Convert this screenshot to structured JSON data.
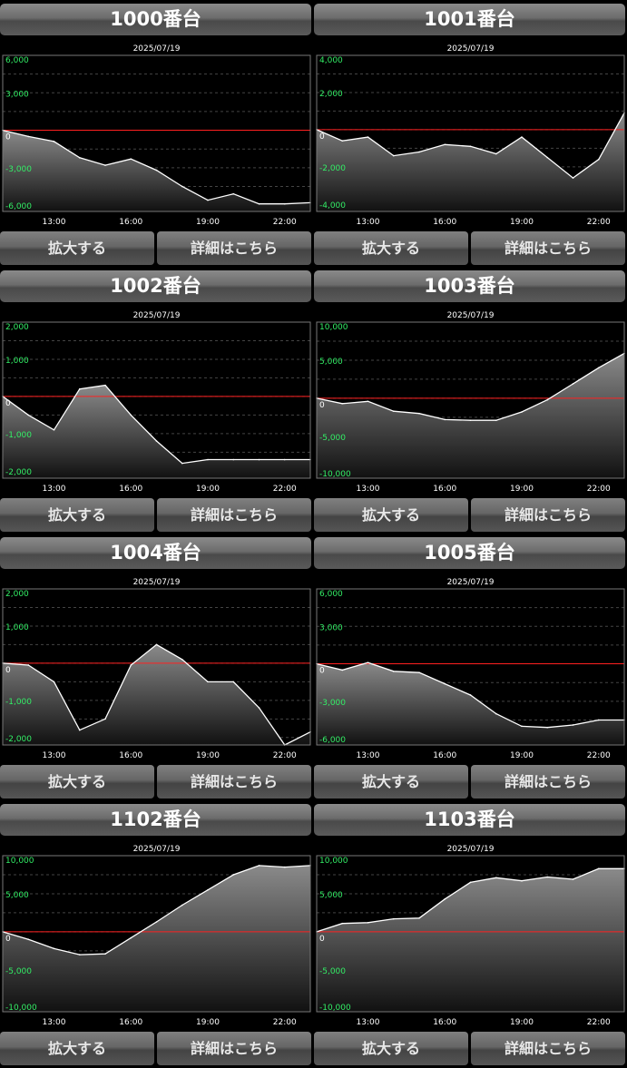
{
  "buttons": {
    "zoom_label": "拡大する",
    "detail_label": "詳細はこちら"
  },
  "colors": {
    "axis_label": "#33ee66",
    "zero_line": "#ff2020",
    "line": "#ffffff",
    "frame": "#777777",
    "grid": "#444444"
  },
  "chart_data": [
    {
      "type": "area",
      "title": "1000番台",
      "date": "2025/07/19",
      "x": [
        "11:00",
        "12:00",
        "13:00",
        "14:00",
        "15:00",
        "16:00",
        "17:00",
        "18:00",
        "19:00",
        "20:00",
        "21:00",
        "22:00",
        "23:00"
      ],
      "xticks": [
        "13:00",
        "16:00",
        "19:00",
        "22:00"
      ],
      "yticks": [
        6000,
        3000,
        0,
        -3000,
        -6000
      ],
      "ytick_labels": [
        "6,000",
        "3,000",
        "0",
        "-3,000",
        "-6,000"
      ],
      "ylim": [
        -6500,
        6000
      ],
      "values": [
        0,
        -500,
        -900,
        -2200,
        -2800,
        -2300,
        -3200,
        -4500,
        -5600,
        -5100,
        -5900,
        -5900,
        -5800
      ]
    },
    {
      "type": "area",
      "title": "1001番台",
      "date": "2025/07/19",
      "x": [
        "11:00",
        "12:00",
        "13:00",
        "14:00",
        "15:00",
        "16:00",
        "17:00",
        "18:00",
        "19:00",
        "20:00",
        "21:00",
        "22:00",
        "23:00"
      ],
      "xticks": [
        "13:00",
        "16:00",
        "19:00",
        "22:00"
      ],
      "yticks": [
        4000,
        2000,
        0,
        -2000,
        -4000
      ],
      "ytick_labels": [
        "4,000",
        "2,000",
        "0",
        "-2,000",
        "-4,000"
      ],
      "ylim": [
        -4400,
        4000
      ],
      "values": [
        0,
        -600,
        -400,
        -1400,
        -1200,
        -800,
        -900,
        -1300,
        -400,
        -1500,
        -2600,
        -1600,
        900
      ]
    },
    {
      "type": "area",
      "title": "1002番台",
      "date": "2025/07/19",
      "x": [
        "11:00",
        "12:00",
        "13:00",
        "14:00",
        "15:00",
        "16:00",
        "17:00",
        "18:00",
        "19:00",
        "20:00",
        "21:00",
        "22:00",
        "23:00"
      ],
      "xticks": [
        "13:00",
        "16:00",
        "19:00",
        "22:00"
      ],
      "yticks": [
        2000,
        1000,
        0,
        -1000,
        -2000
      ],
      "ytick_labels": [
        "2,000",
        "1,000",
        "0",
        "-1,000",
        "-2,000"
      ],
      "ylim": [
        -2200,
        2000
      ],
      "values": [
        0,
        -500,
        -900,
        200,
        300,
        -500,
        -1200,
        -1800,
        -1700,
        -1700,
        -1700,
        -1700,
        -1700
      ]
    },
    {
      "type": "area",
      "title": "1003番台",
      "date": "2025/07/19",
      "x": [
        "11:00",
        "12:00",
        "13:00",
        "14:00",
        "15:00",
        "16:00",
        "17:00",
        "18:00",
        "19:00",
        "20:00",
        "21:00",
        "22:00",
        "23:00"
      ],
      "xticks": [
        "13:00",
        "16:00",
        "19:00",
        "22:00"
      ],
      "yticks": [
        10000,
        5000,
        0,
        -5000,
        -10000
      ],
      "ytick_labels": [
        "10,000",
        "5,000",
        "0",
        "-5,000",
        "-10,000"
      ],
      "ylim": [
        -10500,
        10000
      ],
      "values": [
        0,
        -700,
        -400,
        -1700,
        -2000,
        -2800,
        -2900,
        -2900,
        -1800,
        -200,
        1900,
        4000,
        5900
      ]
    },
    {
      "type": "area",
      "title": "1004番台",
      "date": "2025/07/19",
      "x": [
        "11:00",
        "12:00",
        "13:00",
        "14:00",
        "15:00",
        "16:00",
        "17:00",
        "18:00",
        "19:00",
        "20:00",
        "21:00",
        "22:00",
        "23:00"
      ],
      "xticks": [
        "13:00",
        "16:00",
        "19:00",
        "22:00"
      ],
      "yticks": [
        2000,
        1000,
        0,
        -1000,
        -2000
      ],
      "ytick_labels": [
        "2,000",
        "1,000",
        "0",
        "-1,000",
        "-2,000"
      ],
      "ylim": [
        -2200,
        2000
      ],
      "values": [
        0,
        -50,
        -500,
        -1800,
        -1500,
        -50,
        500,
        100,
        -500,
        -500,
        -1200,
        -2200,
        -1850
      ]
    },
    {
      "type": "area",
      "title": "1005番台",
      "date": "2025/07/19",
      "x": [
        "11:00",
        "12:00",
        "13:00",
        "14:00",
        "15:00",
        "16:00",
        "17:00",
        "18:00",
        "19:00",
        "20:00",
        "21:00",
        "22:00",
        "23:00"
      ],
      "xticks": [
        "13:00",
        "16:00",
        "19:00",
        "22:00"
      ],
      "yticks": [
        6000,
        3000,
        0,
        -3000,
        -6000
      ],
      "ytick_labels": [
        "6,000",
        "3,000",
        "0",
        "-3,000",
        "-6,000"
      ],
      "ylim": [
        -6500,
        6000
      ],
      "values": [
        0,
        -500,
        100,
        -600,
        -700,
        -1600,
        -2500,
        -4000,
        -5000,
        -5100,
        -4900,
        -4500,
        -4500
      ]
    },
    {
      "type": "area",
      "title": "1102番台",
      "date": "2025/07/19",
      "x": [
        "11:00",
        "12:00",
        "13:00",
        "14:00",
        "15:00",
        "16:00",
        "17:00",
        "18:00",
        "19:00",
        "20:00",
        "21:00",
        "22:00",
        "23:00"
      ],
      "xticks": [
        "13:00",
        "16:00",
        "19:00",
        "22:00"
      ],
      "yticks": [
        10000,
        5000,
        0,
        -5000,
        -10000
      ],
      "ytick_labels": [
        "10,000",
        "5,000",
        "0",
        "-5,000",
        "-10,000"
      ],
      "ylim": [
        -10500,
        10000
      ],
      "values": [
        0,
        -1000,
        -2200,
        -3000,
        -2900,
        -800,
        1300,
        3500,
        5500,
        7500,
        8700,
        8500,
        8700
      ]
    },
    {
      "type": "area",
      "title": "1103番台",
      "date": "2025/07/19",
      "x": [
        "11:00",
        "12:00",
        "13:00",
        "14:00",
        "15:00",
        "16:00",
        "17:00",
        "18:00",
        "19:00",
        "20:00",
        "21:00",
        "22:00",
        "23:00"
      ],
      "xticks": [
        "13:00",
        "16:00",
        "19:00",
        "22:00"
      ],
      "yticks": [
        10000,
        5000,
        0,
        -5000,
        -10000
      ],
      "ytick_labels": [
        "10,000",
        "5,000",
        "0",
        "-5,000",
        "-10,000"
      ],
      "ylim": [
        -10500,
        10000
      ],
      "values": [
        0,
        1100,
        1200,
        1700,
        1800,
        4300,
        6500,
        7100,
        6700,
        7200,
        6900,
        8300,
        8300
      ]
    }
  ]
}
